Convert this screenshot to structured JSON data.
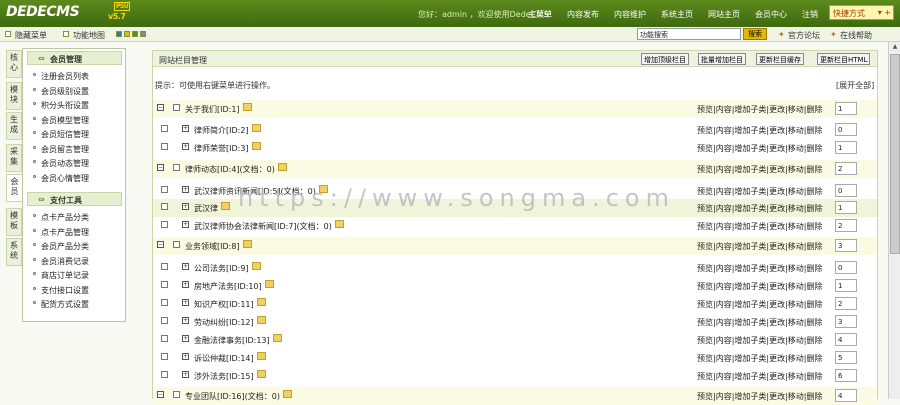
{
  "brand": {
    "logo": "DEDECMS",
    "badge": "PSU",
    "version": "v5.7"
  },
  "header": {
    "welcome": "您好：admin ，欢迎使用DedeCMS！",
    "nav": [
      "主菜单",
      "内容发布",
      "内容维护",
      "系统主页",
      "网站主页",
      "会员中心",
      "注销"
    ],
    "mode_button": "快捷方式"
  },
  "toolbar": {
    "hide_menu": "隐藏菜单",
    "site_map": "功能地图",
    "search_placeholder": "功能搜索",
    "search_button": "搜索",
    "forum": "官方论坛",
    "help": "在线帮助"
  },
  "vtabs": [
    "核心",
    "模块",
    "生成",
    "采集",
    "会员",
    "模板",
    "系统"
  ],
  "menu": {
    "section1": "会员管理",
    "items1": [
      "注册会员列表",
      "会员级别设置",
      "积分头衔设置",
      "会员模型管理",
      "会员短信管理",
      "会员留言管理",
      "会员动态管理",
      "会员心情管理"
    ],
    "section2": "支付工具",
    "items2": [
      "点卡产品分类",
      "点卡产品管理",
      "会员产品分类",
      "会员消费记录",
      "商店订单记录",
      "支付接口设置",
      "配货方式设置"
    ]
  },
  "main": {
    "title": "网站栏目管理",
    "buttons": [
      "增加顶级栏目",
      "批量增加栏目",
      "更新栏目缓存",
      "更新栏目HTML"
    ],
    "tip": "提示：可使用右键菜单进行操作。",
    "expand_all": "[展开全部]",
    "ops": "预览|内容|增加子类|更改|移动|删除",
    "rows": [
      {
        "label": "关于我们[ID:1]",
        "order": "1",
        "level": 0
      },
      {
        "label": "律师简介[ID:2]",
        "order": "0",
        "level": 1
      },
      {
        "label": "律师荣誉[ID:3]",
        "order": "1",
        "level": 1
      },
      {
        "label": "律师动态[ID:4](文档：0)",
        "order": "2",
        "level": 0
      },
      {
        "label": "武汉律师资讯新闻[ID:5](文档：0)",
        "order": "0",
        "level": 1
      },
      {
        "label": "武汉律",
        "order": "1",
        "level": 1
      },
      {
        "label": "武汉律师协会法律新闻[ID:7](文档：0)",
        "order": "2",
        "level": 1
      },
      {
        "label": "业务领域[ID:8]",
        "order": "3",
        "level": 0
      },
      {
        "label": "公司法务[ID:9]",
        "order": "0",
        "level": 1
      },
      {
        "label": "房地产法务[ID:10]",
        "order": "1",
        "level": 1
      },
      {
        "label": "知识产权[ID:11]",
        "order": "2",
        "level": 1
      },
      {
        "label": "劳动纠纷[ID:12]",
        "order": "3",
        "level": 1
      },
      {
        "label": "金融法律事务[ID:13]",
        "order": "4",
        "level": 1
      },
      {
        "label": "诉讼仲裁[ID:14]",
        "order": "5",
        "level": 1
      },
      {
        "label": "涉外法务[ID:15]",
        "order": "6",
        "level": 1
      },
      {
        "label": "专业团队[ID:16](文档：0)",
        "order": "4",
        "level": 0
      }
    ]
  },
  "watermark": "https://www.songma.com"
}
